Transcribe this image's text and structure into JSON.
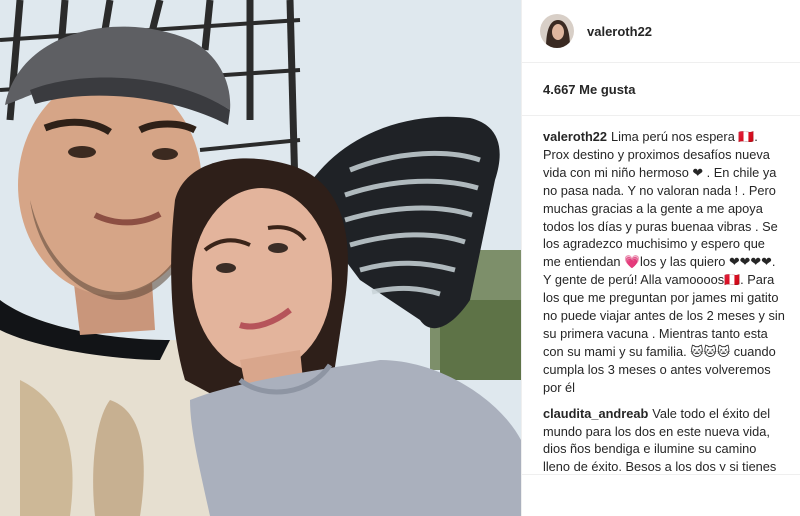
{
  "post": {
    "username": "valeroth22",
    "likes_label": "4.667 Me gusta"
  },
  "comments": [
    {
      "user": "valeroth22",
      "text": "Lima perú nos espera 🇵🇪. Prox destino y proximos desafíos nueva vida con mi niño hermoso ❤ . En chile ya no pasa nada. Y no valoran nada ! . Pero muchas gracias a la gente a me apoya todos los días y puras buenaa vibras . Se los agradezco muchisimo y espero que me entiendan 💗los y las quiero ❤❤❤❤. Y gente de perú! Alla vamoooos🇵🇪. Para los que me preguntan por james mi gatito no puede viajar antes de los 2 meses y sin su primera vacuna . Mientras tanto esta con su mami y su familia. 🐱🐱🐱 cuando cumpla los 3 meses o antes volveremos por él"
    },
    {
      "user": "claudita_andreab",
      "text": "Vale todo el éxito del mundo para los dos en este nueva vida, dios ños bendiga e ilumine su camino lleno de éxito. Besos a los dos y si tienes razon sobre lo que dijiste de este pais, sigue subiendo videos para saber como va la vida aun que no dudo que sera"
    }
  ],
  "colors": {
    "text": "#262626",
    "border": "#efefef",
    "background": "#ffffff"
  }
}
